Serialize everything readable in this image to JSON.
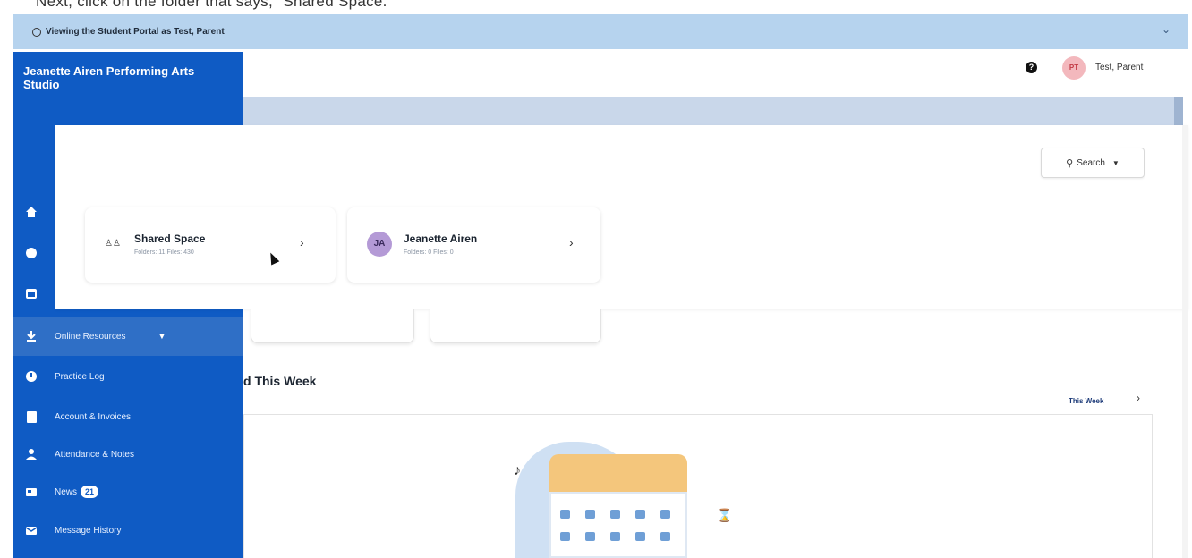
{
  "caption": "Next, click on the folder that says, \"Shared Space.\"",
  "banner": {
    "text": "Viewing the Student Portal as Test, Parent",
    "collapse_icon": "chevron-down-icon"
  },
  "sidebar": {
    "studio_name": "Jeanette Airen Performing Arts Studio",
    "brand_color": "#0f5bc4",
    "icon_only_items": [
      "home-icon",
      "circle-icon",
      "calendar-icon",
      "music-note-icon"
    ],
    "items": [
      {
        "label": "Online Resources",
        "icon": "download-icon",
        "active": true
      },
      {
        "label": "Practice Log",
        "icon": "clock-icon"
      },
      {
        "label": "Account & Invoices",
        "icon": "document-icon"
      },
      {
        "label": "Attendance & Notes",
        "icon": "person-icon"
      },
      {
        "label": "News",
        "icon": "news-icon",
        "badge": "21"
      },
      {
        "label": "Message History",
        "icon": "mail-icon"
      }
    ]
  },
  "header": {
    "help_icon": "?",
    "avatar_initials": "PT",
    "user_name": "Test, Parent"
  },
  "search": {
    "label": "Search",
    "icon": "search-icon"
  },
  "folders": [
    {
      "name": "Shared Space",
      "meta": "Folders: 11  Files: 430",
      "icon": "people-icon"
    },
    {
      "name": "Jeanette Airen",
      "meta": "Folders: 0  Files: 0",
      "initials": "JA"
    }
  ],
  "section": {
    "title_fragment": "d This Week",
    "range_label": "This Week"
  }
}
